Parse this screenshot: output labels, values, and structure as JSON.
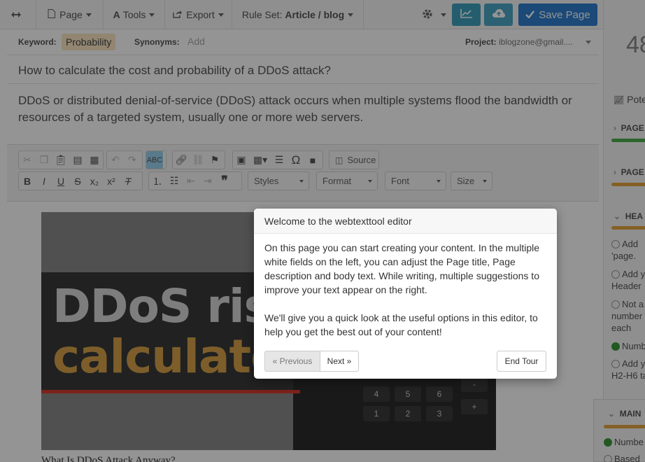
{
  "toolbar": {
    "page_label": "Page",
    "tools_label": "Tools",
    "export_label": "Export",
    "ruleset_prefix": "Rule Set:",
    "ruleset_value": "Article / blog",
    "save_label": "Save Page"
  },
  "keyword_row": {
    "keyword_label": "Keyword:",
    "keyword_value": "Probability",
    "synonyms_label": "Synonyms:",
    "synonyms_placeholder": "Add",
    "project_label": "Project:",
    "project_value": "iblogzone@gmail...."
  },
  "page_title": "How to calculate the cost and probability of a DDoS attack?",
  "page_description": "DDoS or distributed denial-of-service (DDoS) attack occurs when multiple systems flood the bandwidth or resources of a targeted system, usually one or more web servers.",
  "editor_toolbar": {
    "source_label": "Source",
    "styles_label": "Styles",
    "format_label": "Format",
    "font_label": "Font",
    "size_label": "Size"
  },
  "body": {
    "image_line1": "DDoS ris",
    "image_line2": "calculato",
    "calc_keys": [
      "4",
      "5",
      "6",
      "-",
      "1",
      "2",
      "3",
      "+"
    ],
    "first_text": "What Is DDoS Attack Anyway?"
  },
  "right_panel": {
    "score": "48",
    "potential_label": "Pote",
    "sec1": "PAGE",
    "sec2": "PAGE",
    "sec3": "HEA",
    "items": [
      "Add 'page.",
      "Add y Header",
      "Not a number in each",
      "Numb",
      "Add y H2-H6 ta"
    ],
    "main_label": "MAIN",
    "main_items": [
      "Numbe",
      "Based"
    ],
    "colors": {
      "green": "#3a9a3a",
      "orange": "#e4a53e"
    }
  },
  "tour": {
    "title": "Welcome to the webtexttool editor",
    "para1": "On this page you can start creating your content. In the multiple white fields on the left, you can adjust the Page title, Page description and body text. While writing, multiple suggestions to improve your text appear on the right.",
    "para2": "We'll give you a quick look at the useful options in this editor, to help you get the best out of your content!",
    "prev_label": "« Previous",
    "next_label": "Next »",
    "end_label": "End Tour"
  }
}
